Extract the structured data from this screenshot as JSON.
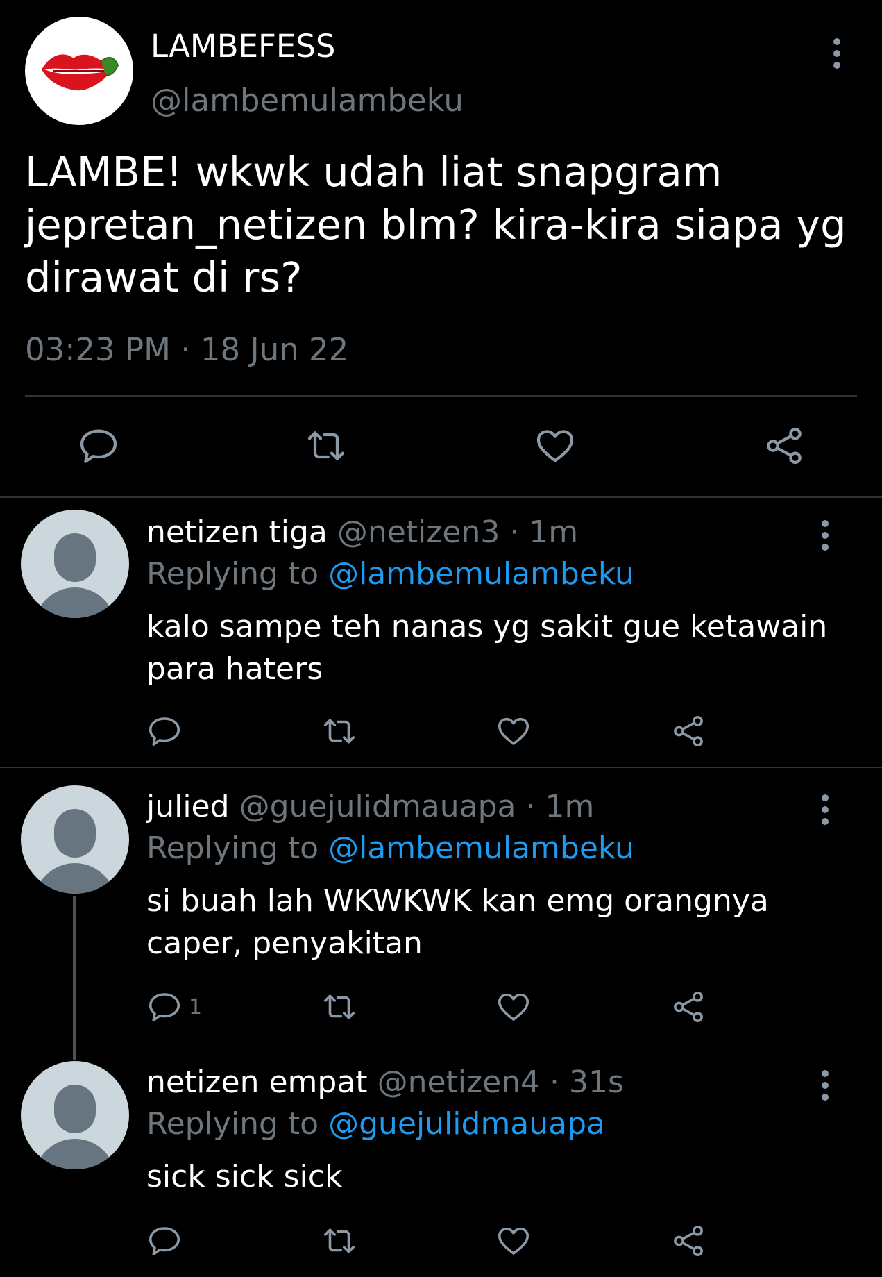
{
  "main_tweet": {
    "display_name": "LAMBEFESS",
    "handle": "@lambemulambeku",
    "text": "LAMBE! wkwk udah liat snapgram jepretan_netizen blm? kira-kira siapa yg dirawat di rs?",
    "timestamp": "03:23 PM · 18 Jun 22",
    "avatar_icon": "red-lips-logo",
    "actions": [
      "reply-icon",
      "retweet-icon",
      "like-icon",
      "share-icon"
    ]
  },
  "replies": [
    {
      "display_name": "netizen tiga",
      "meta": "@netizen3 · 1m",
      "replying_label": "Replying to",
      "replying_to": "@lambemulambeku",
      "text": "kalo sampe teh nanas yg sakit gue ketawain para haters",
      "reply_count": ""
    },
    {
      "display_name": "julied",
      "meta": "@guejulidmauapa · 1m",
      "replying_label": "Replying to",
      "replying_to": "@lambemulambeku",
      "text": "si buah lah WKWKWK kan emg orangnya caper, penyakitan",
      "reply_count": "1"
    },
    {
      "display_name": "netizen empat",
      "meta": "@netizen4 · 31s",
      "replying_label": "Replying to",
      "replying_to": "@guejulidmauapa",
      "text": "sick sick sick",
      "reply_count": ""
    }
  ],
  "colors": {
    "background": "#000000",
    "secondary_text": "#6e767d",
    "link": "#1d9bf0",
    "divider": "#2f3336"
  }
}
